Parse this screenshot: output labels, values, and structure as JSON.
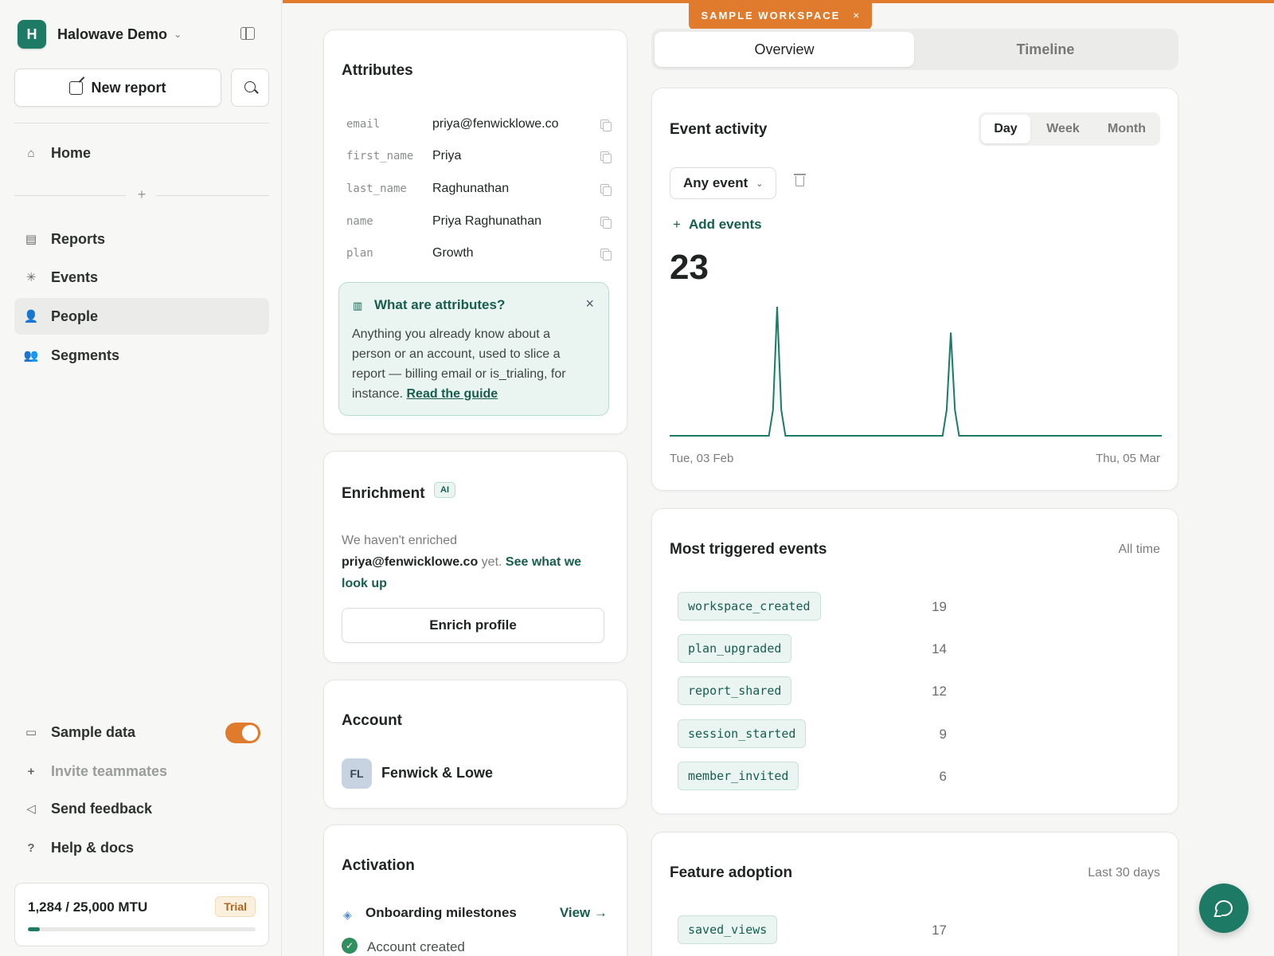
{
  "sidebar": {
    "workspace_initial": "H",
    "workspace_name": "Halowave Demo",
    "new_report_label": "New report",
    "nav": [
      {
        "label": "Home",
        "icon": "home-icon"
      },
      {
        "label": "Reports",
        "icon": "reports-icon"
      },
      {
        "label": "Events",
        "icon": "sparkle-icon"
      },
      {
        "label": "People",
        "icon": "person-icon",
        "active": true
      },
      {
        "label": "Segments",
        "icon": "people-group-icon"
      }
    ],
    "bottom": [
      {
        "label": "Sample data",
        "icon": "database-icon"
      },
      {
        "label": "Invite teammates",
        "icon": "plus-icon"
      },
      {
        "label": "Send feedback",
        "icon": "megaphone-icon"
      },
      {
        "label": "Help & docs",
        "icon": "help-icon"
      }
    ],
    "sample_data_enabled": true,
    "mtu": {
      "text": "1,284 / 25,000 MTU",
      "badge": "Trial",
      "used": 1284,
      "limit": 25000
    }
  },
  "banner": {
    "label": "SAMPLE WORKSPACE",
    "close": "×"
  },
  "attributes": {
    "title": "Attributes",
    "rows": [
      {
        "key": "email",
        "value": "priya@fenwicklowe.co"
      },
      {
        "key": "first_name",
        "value": "Priya"
      },
      {
        "key": "last_name",
        "value": "Raghunathan"
      },
      {
        "key": "name",
        "value": "Priya Raghunathan"
      },
      {
        "key": "plan",
        "value": "Growth"
      }
    ],
    "info": {
      "title": "What are attributes?",
      "body": "Anything you already know about a person or an account, used to slice a report — billing email or is_trialing, for instance.",
      "link": "Read the guide"
    }
  },
  "enrichment": {
    "title": "Enrichment",
    "badge": "AI",
    "text_prefix": "We haven't enriched",
    "email": "priya@fenwicklowe.co",
    "text_suffix": "yet.",
    "link": "See what we look up",
    "button": "Enrich profile"
  },
  "account": {
    "title": "Account",
    "initials": "FL",
    "name": "Fenwick & Lowe"
  },
  "activation": {
    "title": "Activation",
    "milestone_label": "Onboarding milestones",
    "view_link": "View",
    "first_item": "Account created"
  },
  "tabs": [
    {
      "label": "Overview",
      "active": true
    },
    {
      "label": "Timeline",
      "active": false
    }
  ],
  "event_activity": {
    "title": "Event activity",
    "periods": [
      {
        "label": "Day",
        "active": true
      },
      {
        "label": "Week",
        "active": false
      },
      {
        "label": "Month",
        "active": false
      }
    ],
    "filter": "Any event",
    "add_events": "Add events",
    "total": "23",
    "start_date": "Tue, 03 Feb",
    "end_date": "Thu, 05 Mar"
  },
  "chart_data": {
    "type": "area",
    "x_start": "Tue, 03 Feb",
    "x_end": "Thu, 05 Mar",
    "values": [
      0,
      0,
      0,
      0,
      0,
      0,
      0,
      0,
      0,
      0,
      0,
      0,
      0,
      0,
      0,
      0,
      0,
      0,
      0,
      0,
      0,
      0,
      0,
      0,
      0,
      2,
      10,
      2,
      0,
      0,
      0,
      0,
      0,
      0,
      0,
      0,
      0,
      0,
      0,
      0,
      0,
      0,
      0,
      0,
      0,
      0,
      0,
      0,
      0,
      0,
      0,
      0,
      0,
      0,
      0,
      0,
      0,
      0,
      0,
      0,
      0,
      0,
      0,
      0,
      0,
      0,
      0,
      2,
      8,
      2,
      0,
      0,
      0,
      0,
      0,
      0,
      0,
      0,
      0,
      0,
      0,
      0,
      0,
      0,
      0,
      0,
      0,
      0,
      0,
      0,
      0,
      0,
      0,
      0,
      0,
      0,
      0,
      0,
      0,
      0,
      0,
      0,
      0,
      0,
      0,
      0,
      0,
      0,
      0,
      0,
      0,
      0,
      0,
      0,
      0,
      0,
      0,
      0,
      0,
      0
    ],
    "ylim": [
      0,
      10
    ],
    "grid": false,
    "color": "#1c7a65"
  },
  "most_triggered": {
    "title": "Most triggered events",
    "range": "All time",
    "events": [
      {
        "name": "workspace_created",
        "count": "19"
      },
      {
        "name": "plan_upgraded",
        "count": "14"
      },
      {
        "name": "report_shared",
        "count": "12"
      },
      {
        "name": "session_started",
        "count": "9"
      },
      {
        "name": "member_invited",
        "count": "6"
      }
    ]
  },
  "feature_adoption": {
    "title": "Feature adoption",
    "range": "Last 30 days",
    "features": [
      {
        "name": "saved_views",
        "count": "17"
      }
    ]
  },
  "colors": {
    "accent": "#1c7a65",
    "warning": "#e07b2e"
  }
}
